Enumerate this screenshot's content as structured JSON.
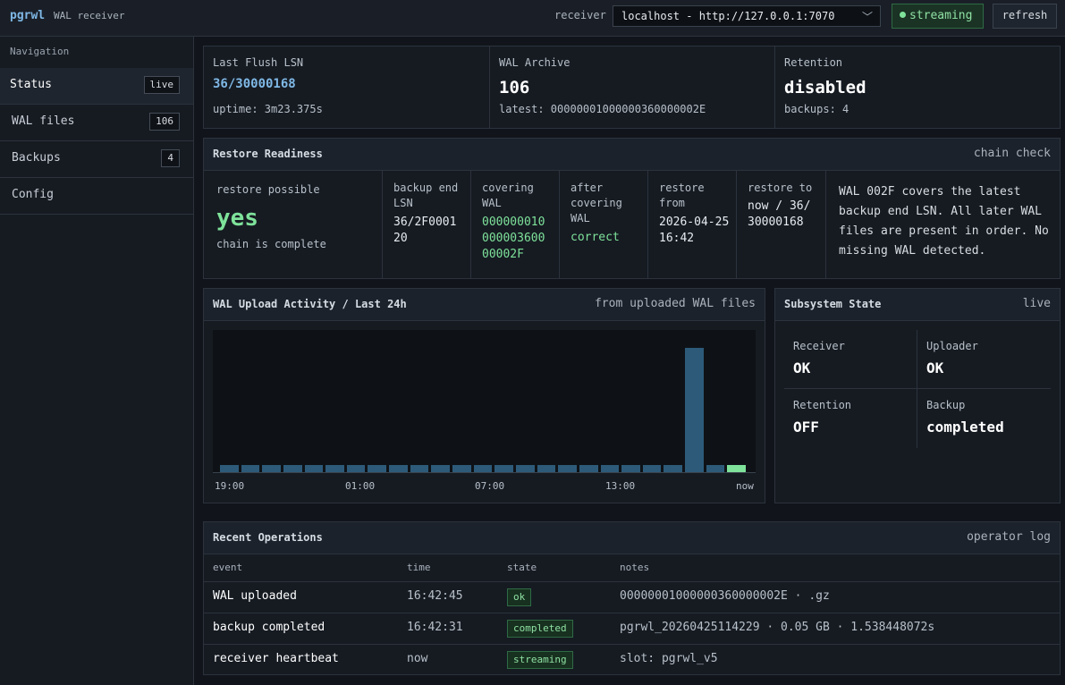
{
  "app": {
    "name": "pgrwl",
    "subtitle": "WAL receiver"
  },
  "header": {
    "receiver_label": "receiver",
    "receiver_selected": "localhost - http://127.0.0.1:7070",
    "status": "streaming",
    "refresh_label": "refresh"
  },
  "sidebar": {
    "title": "Navigation",
    "items": [
      {
        "label": "Status",
        "count": "live",
        "active": true
      },
      {
        "label": "WAL files",
        "count": "106"
      },
      {
        "label": "Backups",
        "count": "4"
      },
      {
        "label": "Config",
        "count": ""
      }
    ]
  },
  "stats": [
    {
      "label": "Last Flush LSN",
      "value": "36/30000168",
      "sub": "uptime: 3m23.375s"
    },
    {
      "label": "WAL Archive",
      "value": "106",
      "sub": "latest: 00000001000000360000002E"
    },
    {
      "label": "Retention",
      "value": "disabled",
      "sub": "backups: 4"
    }
  ],
  "restore": {
    "title": "Restore Readiness",
    "aside": "chain check",
    "possible_label": "restore possible",
    "possible_value": "yes",
    "possible_sub": "chain is complete",
    "columns": [
      {
        "label": "backup end LSN",
        "value": "36/2F000120"
      },
      {
        "label": "covering WAL",
        "value": "00000001000000360000002F"
      },
      {
        "label": "after covering WAL",
        "value": "correct"
      },
      {
        "label": "restore from",
        "value": "2026-04-25 16:42"
      },
      {
        "label": "restore to",
        "value": "now / 36/30000168"
      }
    ],
    "note": "WAL 002F covers the latest backup end LSN. All later WAL files are present in order. No missing WAL detected."
  },
  "activity": {
    "title": "WAL Upload Activity / Last 24h",
    "aside": "from uploaded WAL files",
    "colors": {
      "bar": "#2d5a79",
      "current": "#7ee29a"
    }
  },
  "chart_data": {
    "type": "bar",
    "x_ticks": [
      "19:00",
      "01:00",
      "07:00",
      "13:00",
      "now"
    ],
    "values": [
      1,
      1,
      1,
      1,
      1,
      1,
      1,
      1,
      1,
      1,
      1,
      1,
      1,
      1,
      1,
      1,
      1,
      1,
      1,
      1,
      1,
      1,
      16,
      1,
      1
    ],
    "highlight_last": true,
    "ylim": [
      0,
      17
    ]
  },
  "subsystems": {
    "title": "Subsystem State",
    "aside": "live",
    "items": [
      {
        "label": "Receiver",
        "value": "OK"
      },
      {
        "label": "Uploader",
        "value": "OK"
      },
      {
        "label": "Retention",
        "value": "OFF"
      },
      {
        "label": "Backup",
        "value": "completed"
      }
    ]
  },
  "operations": {
    "title": "Recent Operations",
    "aside": "operator log",
    "columns": [
      "event",
      "time",
      "state",
      "notes"
    ],
    "rows": [
      {
        "event": "WAL uploaded",
        "time": "16:42:45",
        "state": "ok",
        "notes": "00000001000000360000002E · .gz"
      },
      {
        "event": "backup completed",
        "time": "16:42:31",
        "state": "completed",
        "notes": "pgrwl_20260425114229 · 0.05 GB · 1.538448072s"
      },
      {
        "event": "receiver heartbeat",
        "time": "now",
        "state": "streaming",
        "notes": "slot: pgrwl_v5"
      }
    ]
  }
}
